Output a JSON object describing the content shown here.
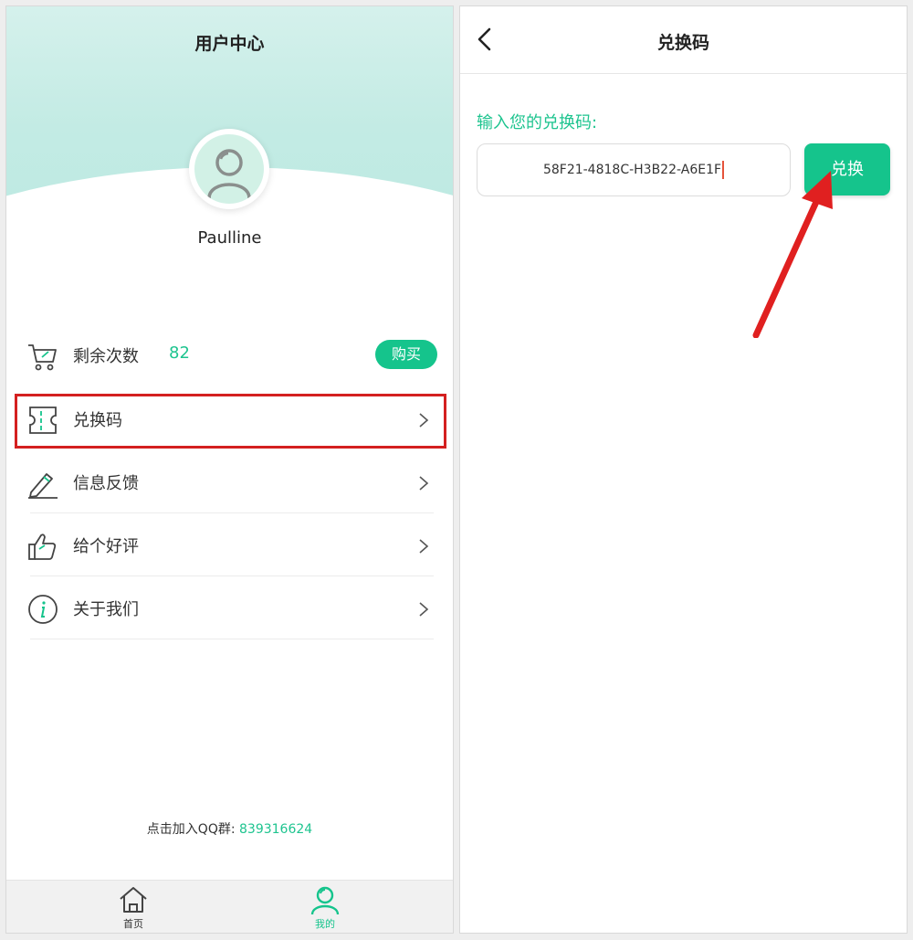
{
  "left_screen": {
    "title": "用户中心",
    "username": "Paulline",
    "menu": {
      "remaining": {
        "label": "剩余次数",
        "count": "82",
        "buy_label": "购买",
        "icon": "cart-icon"
      },
      "redeem": {
        "label": "兑换码",
        "icon": "ticket-icon"
      },
      "feedback": {
        "label": "信息反馈",
        "icon": "pencil-icon"
      },
      "rate": {
        "label": "给个好评",
        "icon": "thumbs-up-icon"
      },
      "about": {
        "label": "关于我们",
        "icon": "info-icon"
      }
    },
    "qq_group": {
      "text": "点击加入QQ群:",
      "number": "839316624"
    },
    "tabbar": [
      {
        "label": "首页",
        "icon": "home-icon",
        "active": false
      },
      {
        "label": "我的",
        "icon": "user-icon",
        "active": true
      }
    ]
  },
  "right_screen": {
    "title": "兑换码",
    "prompt": "输入您的兑换码:",
    "code_value": "58F21-4818C-H3B22-A6E1F",
    "redeem_button": "兑换"
  },
  "colors": {
    "accent": "#15c48c",
    "accent_text": "#1ec48f",
    "highlight": "#d42020",
    "annotation_arrow": "#e02020"
  }
}
